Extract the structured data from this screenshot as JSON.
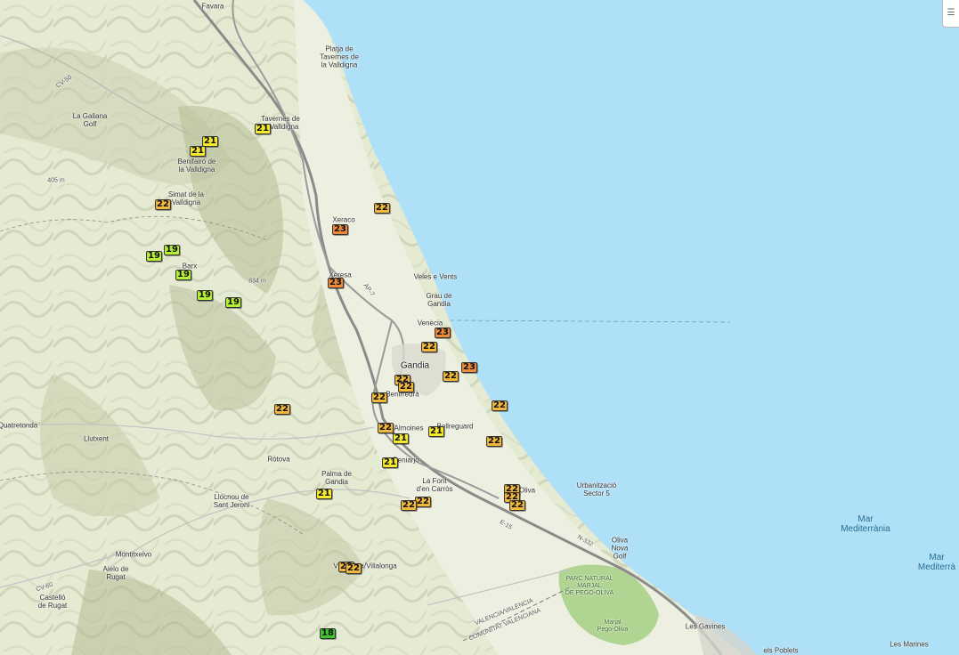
{
  "colors": {
    "sea": "#aee0f8",
    "land": "#e7ecd8",
    "park": "#a8d08a",
    "temp_18": "#3ec82e",
    "temp_19": "#b6f036",
    "temp_21": "#f5ea2c",
    "temp_22": "#f2b83c",
    "temp_23": "#ee8a3a"
  },
  "labels": [
    {
      "id": "favara",
      "text": "Favara",
      "kind": "town-small"
    },
    {
      "id": "platja-tavernes",
      "text": "Platja de\nTavernes de\nla Valldigna",
      "kind": "town-small"
    },
    {
      "id": "la-galiana",
      "text": "La Galiana\nGolf",
      "kind": "town-small"
    },
    {
      "id": "tavernes",
      "text": "Tavernes de\nla Valldigna",
      "kind": "town-small"
    },
    {
      "id": "benifairo",
      "text": "Benifairó de\nla Valldigna",
      "kind": "town-small"
    },
    {
      "id": "elev-405",
      "text": "405 m",
      "kind": "road"
    },
    {
      "id": "simat",
      "text": "Simat de la\nValldigna",
      "kind": "town-small"
    },
    {
      "id": "xeraco",
      "text": "Xeraco",
      "kind": "town-small"
    },
    {
      "id": "barx",
      "text": "Barx",
      "kind": "town-small"
    },
    {
      "id": "elev-834",
      "text": "834 m",
      "kind": "road"
    },
    {
      "id": "xeresa",
      "text": "Xeresa",
      "kind": "town-small"
    },
    {
      "id": "veles",
      "text": "Veles e Vents",
      "kind": "town-small"
    },
    {
      "id": "grau",
      "text": "Grau de\nGandia",
      "kind": "town-small"
    },
    {
      "id": "venecia",
      "text": "Venècia",
      "kind": "town-small"
    },
    {
      "id": "gandia",
      "text": "Gandia",
      "kind": "town"
    },
    {
      "id": "benirredra",
      "text": "Benirredrà",
      "kind": "town-small"
    },
    {
      "id": "quatretonda",
      "text": "Quatretonda",
      "kind": "town-small"
    },
    {
      "id": "lluxent",
      "text": "Llutxent",
      "kind": "town-small"
    },
    {
      "id": "almoines",
      "text": "Almoines",
      "kind": "town-small"
    },
    {
      "id": "bellreguard",
      "text": "Bellreguard",
      "kind": "town-small"
    },
    {
      "id": "rotova",
      "text": "Ròtova",
      "kind": "town-small"
    },
    {
      "id": "beniarjo",
      "text": "Beniarjó",
      "kind": "town-small"
    },
    {
      "id": "palma",
      "text": "Palma de\nGandia",
      "kind": "town-small"
    },
    {
      "id": "llocnou",
      "text": "Llocnou de\nSant Jeroni",
      "kind": "town-small"
    },
    {
      "id": "la-font",
      "text": "La Font\nd'en Carròs",
      "kind": "town-small"
    },
    {
      "id": "oliva",
      "text": "Oliva",
      "kind": "town-small"
    },
    {
      "id": "urbanitzacio",
      "text": "Urbanització\nSector 5",
      "kind": "town-small"
    },
    {
      "id": "mar1",
      "text": "Mar\nMediterrània",
      "kind": "sea"
    },
    {
      "id": "mar2",
      "text": "Mar\nMediterrà",
      "kind": "sea"
    },
    {
      "id": "montitxelvo",
      "text": "Montitxelvo",
      "kind": "town-small"
    },
    {
      "id": "aielo",
      "text": "Aielo de\nRugat",
      "kind": "town-small"
    },
    {
      "id": "oliva-golf",
      "text": "Oliva\nNova\nGolf",
      "kind": "town-small"
    },
    {
      "id": "castello",
      "text": "Castelló\nde Rugat",
      "kind": "town-small"
    },
    {
      "id": "vilallonga",
      "text": "Vilallonga/Villalonga",
      "kind": "town-small"
    },
    {
      "id": "parc",
      "text": "PARC NATURAL\nMARJAL\nDE PEGO-OLIVA",
      "kind": "park"
    },
    {
      "id": "marjal",
      "text": "Marjal\nPego-Oliva",
      "kind": "park"
    },
    {
      "id": "les-gavines",
      "text": "Les Gavines",
      "kind": "town-small"
    },
    {
      "id": "els-poblets",
      "text": "els Poblets",
      "kind": "town-small"
    },
    {
      "id": "les-marines",
      "text": "Les Marines",
      "kind": "town-small"
    },
    {
      "id": "valencia-boundary",
      "text": "VALENCIA/VALÈNCIA",
      "kind": "road"
    },
    {
      "id": "comunitat",
      "text": "COMUNITAT VALENCIANA",
      "kind": "road"
    },
    {
      "id": "road-cv50",
      "text": "CV-50",
      "kind": "road"
    },
    {
      "id": "road-n332",
      "text": "N-332",
      "kind": "road"
    },
    {
      "id": "road-e15",
      "text": "E-15",
      "kind": "road"
    },
    {
      "id": "road-ap7",
      "text": "AP-7",
      "kind": "road"
    },
    {
      "id": "road-cv60",
      "text": "CV-60",
      "kind": "road"
    }
  ],
  "temperature_markers": [
    {
      "value": "21"
    },
    {
      "value": "21"
    },
    {
      "value": "21"
    },
    {
      "value": "22"
    },
    {
      "value": "22"
    },
    {
      "value": "23"
    },
    {
      "value": "19"
    },
    {
      "value": "19"
    },
    {
      "value": "19"
    },
    {
      "value": "19"
    },
    {
      "value": "19"
    },
    {
      "value": "23"
    },
    {
      "value": "23"
    },
    {
      "value": "22"
    },
    {
      "value": "23"
    },
    {
      "value": "22"
    },
    {
      "value": "22"
    },
    {
      "value": "22"
    },
    {
      "value": "22"
    },
    {
      "value": "22"
    },
    {
      "value": "22"
    },
    {
      "value": "22"
    },
    {
      "value": "21"
    },
    {
      "value": "21"
    },
    {
      "value": "22"
    },
    {
      "value": "21"
    },
    {
      "value": "21"
    },
    {
      "value": "22"
    },
    {
      "value": "22"
    },
    {
      "value": "22"
    },
    {
      "value": "22"
    },
    {
      "value": "22"
    },
    {
      "value": "22"
    },
    {
      "value": "22"
    },
    {
      "value": "18"
    }
  ]
}
